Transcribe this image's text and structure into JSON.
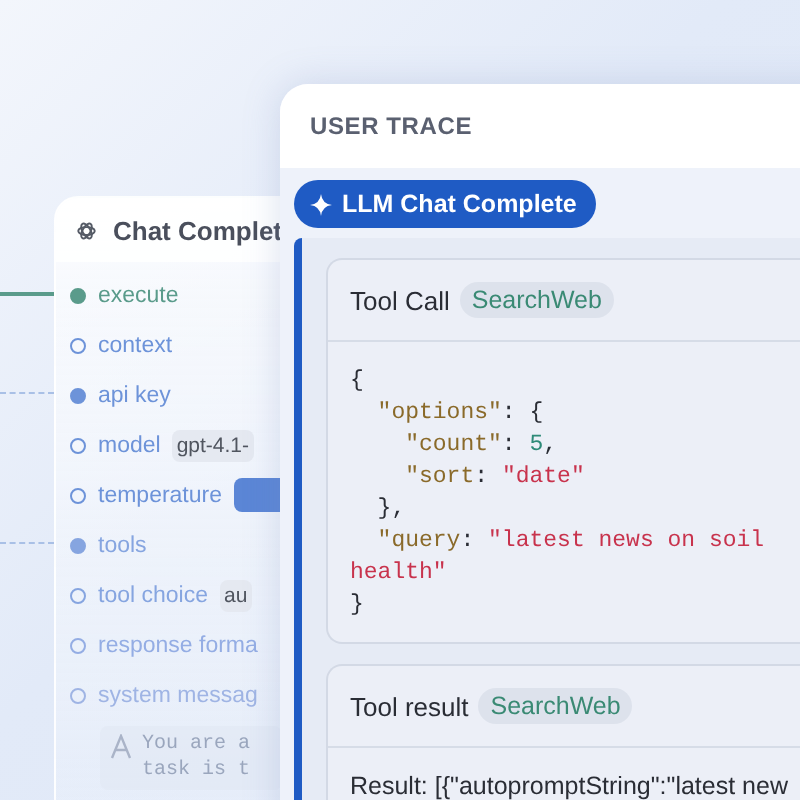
{
  "node_card": {
    "title": "Chat Complet",
    "ports": [
      {
        "label": "execute",
        "filled": true,
        "color": "#5a9b8b",
        "connected": true,
        "dashed": false
      },
      {
        "label": "context",
        "filled": false,
        "color": "#6d93d9"
      },
      {
        "label": "api key",
        "filled": true,
        "color": "#6d93d9",
        "connected": true,
        "dashed": true
      },
      {
        "label": "model",
        "filled": false,
        "color": "#6d93d9",
        "chip": {
          "kind": "text",
          "value": "gpt-4.1-"
        }
      },
      {
        "label": "temperature",
        "filled": false,
        "color": "#6d93d9",
        "chip": {
          "kind": "bar"
        }
      },
      {
        "label": "tools",
        "filled": true,
        "color": "#86a5e0",
        "connected": true,
        "dashed": true
      },
      {
        "label": "tool choice",
        "filled": false,
        "color": "#86a5e0",
        "chip": {
          "kind": "text",
          "value": "au"
        }
      },
      {
        "label": "response forma",
        "filled": false,
        "color": "#94ade4"
      },
      {
        "label": "system messag",
        "filled": false,
        "color": "#9fb4e4"
      }
    ],
    "message_lines": [
      "You are a",
      "task is t"
    ]
  },
  "trace": {
    "title": "USER TRACE",
    "step": "LLM Chat Complete",
    "tool_call": {
      "label": "Tool Call",
      "tool": "SearchWeb",
      "code": [
        [
          {
            "kind": "punct",
            "text": "{"
          }
        ],
        [
          {
            "kind": "key",
            "text": "  \"options\""
          },
          {
            "kind": "punct",
            "text": ": {"
          }
        ],
        [
          {
            "kind": "key",
            "text": "    \"count\""
          },
          {
            "kind": "punct",
            "text": ": "
          },
          {
            "kind": "number",
            "text": "5"
          },
          {
            "kind": "punct",
            "text": ","
          }
        ],
        [
          {
            "kind": "key",
            "text": "    \"sort"
          },
          {
            "kind": "punct",
            "text": ": "
          },
          {
            "kind": "string",
            "text": "\"date\""
          }
        ],
        [
          {
            "kind": "punct",
            "text": "  },"
          }
        ],
        [
          {
            "kind": "key",
            "text": "  \"query"
          },
          {
            "kind": "punct",
            "text": ": "
          },
          {
            "kind": "string",
            "text": "\"latest news on soil"
          }
        ],
        [
          {
            "kind": "string",
            "text": "health\""
          }
        ],
        [
          {
            "kind": "punct",
            "text": "}"
          }
        ]
      ]
    },
    "tool_result": {
      "label": "Tool result",
      "tool": "SearchWeb",
      "result": "Result: [{\"autopromptString\":\"latest new"
    }
  }
}
